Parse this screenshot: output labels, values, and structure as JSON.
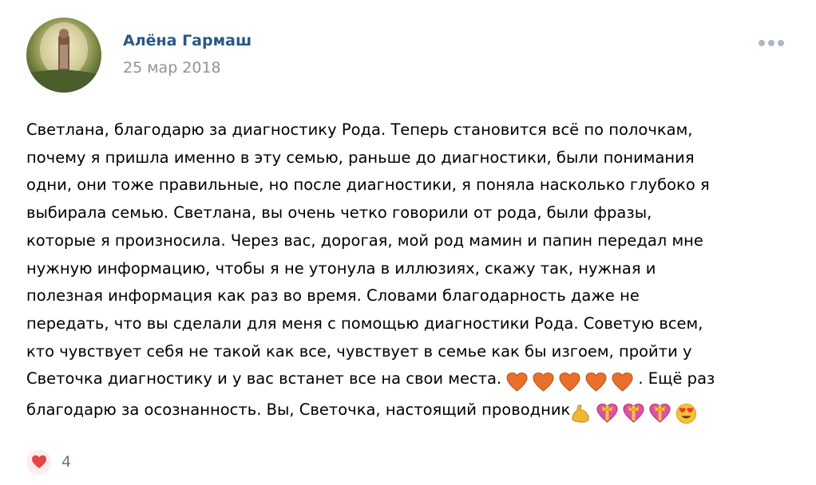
{
  "post": {
    "author": "Алёна Гармаш",
    "date": "25 мар 2018",
    "text_lines": [
      "Светлана, благодарю за диагностику Рода. Теперь становится всё по полочкам,",
      "почему я пришла именно в эту семью, раньше до диагностики, были понимания",
      "одни, они тоже правильные, но после диагностики, я поняла насколько глубоко я",
      "выбирала семью. Светлана, вы очень четко говорили от рода, были фразы,",
      "которые я произносила. Через вас, дорогая, мой род мамин и папин передал мне",
      "нужную информацию, чтобы я не утонула в иллюзиях, скажу так, нужная и",
      "полезная информация как раз во время. Словами благодарность даже не",
      "передать, что вы сделали для меня с помощью диагностики Рода. Советую всем,",
      "кто чувствует себя не такой как все, чувствует в семье как бы изгоем, пройти у"
    ],
    "line10_text": "Светочка диагностику и у вас встанет все на свои места.",
    "line10_tail": ". Ещё раз",
    "line11_text": "благодарю за осознанность. Вы, Светочка, настоящий проводник",
    "line10_emojis": [
      "orange-heart",
      "orange-heart",
      "orange-heart",
      "orange-heart",
      "orange-heart"
    ],
    "line11_emojis": [
      "flexed-biceps",
      "heart-with-ribbon",
      "heart-with-ribbon",
      "heart-with-ribbon",
      "heart-eyes-face"
    ],
    "likes": "4"
  },
  "colors": {
    "author": "#2a5885",
    "date": "#939393",
    "like_heart": "#e64646",
    "like_bg": "#ffecec",
    "more_dots": "#aeb7c2"
  }
}
